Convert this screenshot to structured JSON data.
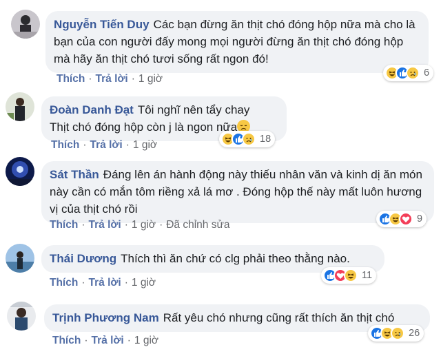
{
  "comments": [
    {
      "author": "Nguyễn Tiến Duy",
      "text": "Các bạn đừng ăn thịt chó đóng hộp nữa mà cho là bạn của con người đấy mong mọi người đừng ăn thịt chó đóng hộp mà hãy ăn thịt chó tươi sống rất ngon đó!",
      "like_label": "Thích",
      "reply_label": "Trả lời",
      "time": "1 giờ",
      "reaction_count": "6",
      "reactions": [
        "haha-icon",
        "like-icon",
        "sad-icon"
      ]
    },
    {
      "author": "Đoàn Danh Đạt",
      "text_line1": "Tôi nghĩ nên tẩy chay",
      "text_line2": "Thịt chó đóng hộp còn j là ngon nữa",
      "like_label": "Thích",
      "reply_label": "Trả lời",
      "time": "1 giờ",
      "reaction_count": "18",
      "reactions": [
        "haha-icon",
        "like-icon",
        "sad-icon"
      ]
    },
    {
      "author": "Sát Thần",
      "text": "Đáng lên án hành động này thiếu nhân văn và kinh dị ăn món này cần có mắn tôm riềng xả lá mơ . Đóng hộp thế này mất luôn hương vị của thịt chó rồi",
      "like_label": "Thích",
      "reply_label": "Trả lời",
      "time": "1 giờ",
      "edited_label": "Đã chỉnh sửa",
      "reaction_count": "9",
      "reactions": [
        "like-icon",
        "haha-icon",
        "love-icon"
      ]
    },
    {
      "author": "Thái Dương",
      "text": "Thích thì ăn chứ có clg phải theo thằng nào.",
      "like_label": "Thích",
      "reply_label": "Trả lời",
      "time": "1 giờ",
      "reaction_count": "11",
      "reactions": [
        "like-icon",
        "love-icon",
        "haha-icon"
      ]
    },
    {
      "author": "Trịnh Phương Nam",
      "text": "Rất yêu chó nhưng cũng rất thích ăn thịt chó",
      "like_label": "Thích",
      "reply_label": "Trả lời",
      "time": "1 giờ",
      "reaction_count": "26",
      "reactions": [
        "like-icon",
        "haha-icon",
        "sad-icon"
      ]
    }
  ],
  "colors": {
    "bubble": "#f0f2f5",
    "author": "#385898",
    "meta": "#65676b",
    "like": "#1b74e4",
    "love": "#f33e58",
    "haha": "#f7c844"
  }
}
